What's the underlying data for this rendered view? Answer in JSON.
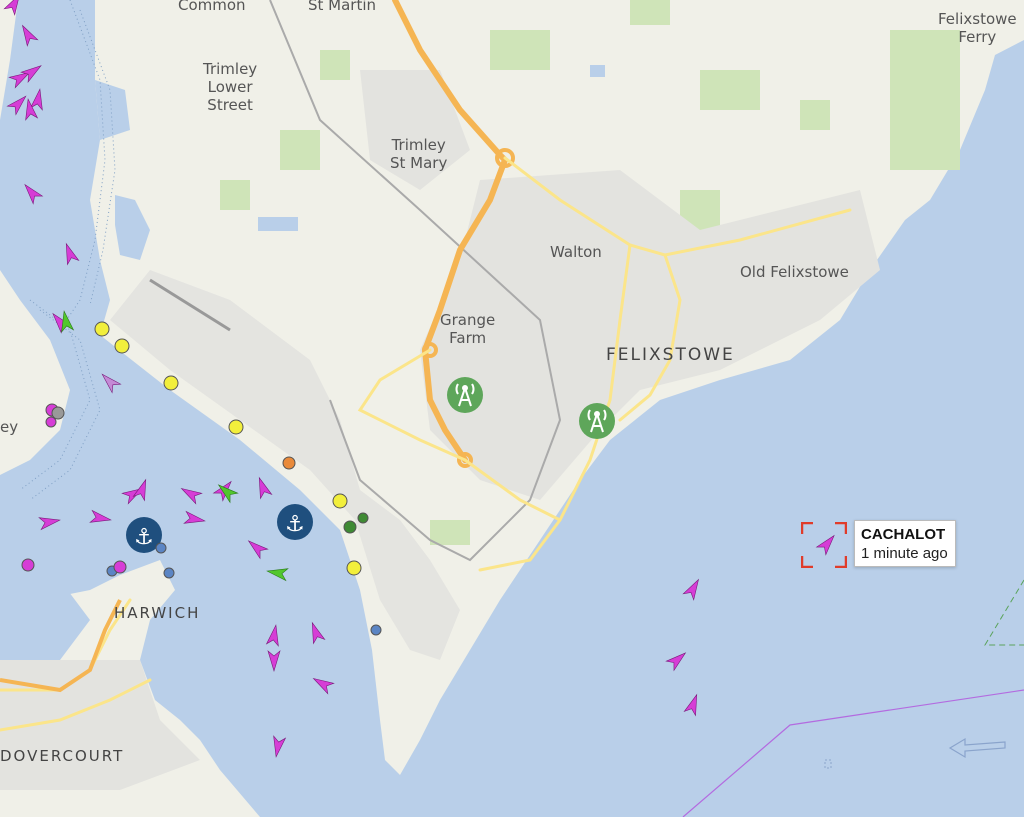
{
  "places": {
    "common": "Common",
    "st_martin": "St Martin",
    "felixstowe_ferry_1": "Felixstowe",
    "felixstowe_ferry_2": "Ferry",
    "trimley_lower_1": "Trimley",
    "trimley_lower_2": "Lower",
    "trimley_lower_3": "Street",
    "trimley_mary_1": "Trimley",
    "trimley_mary_2": "St Mary",
    "walton": "Walton",
    "old_felixstowe": "Old Felixstowe",
    "grange_1": "Grange",
    "grange_2": "Farm",
    "felixstowe": "FELIXSTOWE",
    "harwich": "HARWICH",
    "dovercourt": "DOVERCOURT",
    "ey": "ey"
  },
  "popup": {
    "name": "CACHALOT",
    "time": "1 minute ago"
  },
  "colors": {
    "sea": "#b9cfe9",
    "land": "#f0f0e8",
    "park": "#cfe4b8",
    "road_major": "#f5b553",
    "road_minor": "#fbe58a",
    "vessel_pink": "#d63dd6",
    "vessel_green": "#52c72d",
    "yellow_marker": "#f2ef3c",
    "selection_red": "#e03c2a",
    "anchorage": "#1f4f7e",
    "station": "#5ea65a"
  },
  "icons": {
    "anchor": "anchor-icon",
    "mast": "radio-mast-icon",
    "vessel": "vessel-arrow-icon"
  }
}
